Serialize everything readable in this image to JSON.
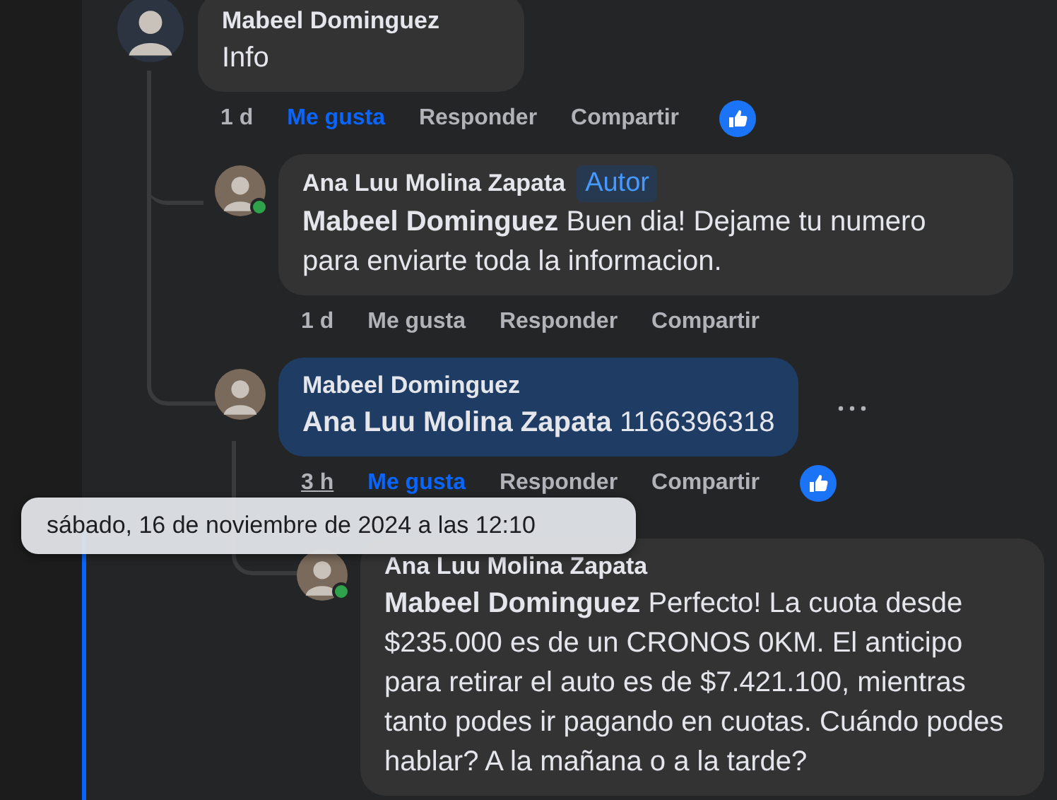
{
  "comments": [
    {
      "author": "Mabeel Dominguez",
      "text": "Info",
      "highlighted": false,
      "actions": {
        "time": "1 d",
        "time_underlined": false,
        "like": "Me gusta",
        "liked": true,
        "reply": "Responder",
        "share": "Compartir",
        "reaction": true
      },
      "children": [
        {
          "author": "Ana Luu Molina Zapata",
          "badge": "Autor",
          "text": "**Mabeel Dominguez** Buen dia! Dejame tu numero para enviarte toda la informacion.",
          "highlighted": false,
          "online": true,
          "actions": {
            "time": "1 d",
            "time_underlined": false,
            "like": "Me gusta",
            "liked": false,
            "reply": "Responder",
            "share": "Compartir"
          }
        },
        {
          "author": "Mabeel Dominguez",
          "text": "**Ana Luu Molina Zapata** 1166396318",
          "highlighted": true,
          "more_menu": true,
          "actions": {
            "time": "3 h",
            "time_underlined": true,
            "like": "Me gusta",
            "liked": true,
            "reply": "Responder",
            "share": "Compartir",
            "reaction": true
          },
          "children": [
            {
              "author": "Ana Luu Molina Zapata",
              "text": "**Mabeel Dominguez** Perfecto! La cuota desde $235.000 es de un CRONOS 0KM. El anticipo para retirar el auto es de $7.421.100, mientras tanto podes ir pagando en cuotas. Cuándo podes hablar? A la mañana o a la tarde?",
              "highlighted": false,
              "online": true
            }
          ]
        }
      ]
    }
  ],
  "tooltip": "sábado, 16 de noviembre de 2024 a las 12:10"
}
